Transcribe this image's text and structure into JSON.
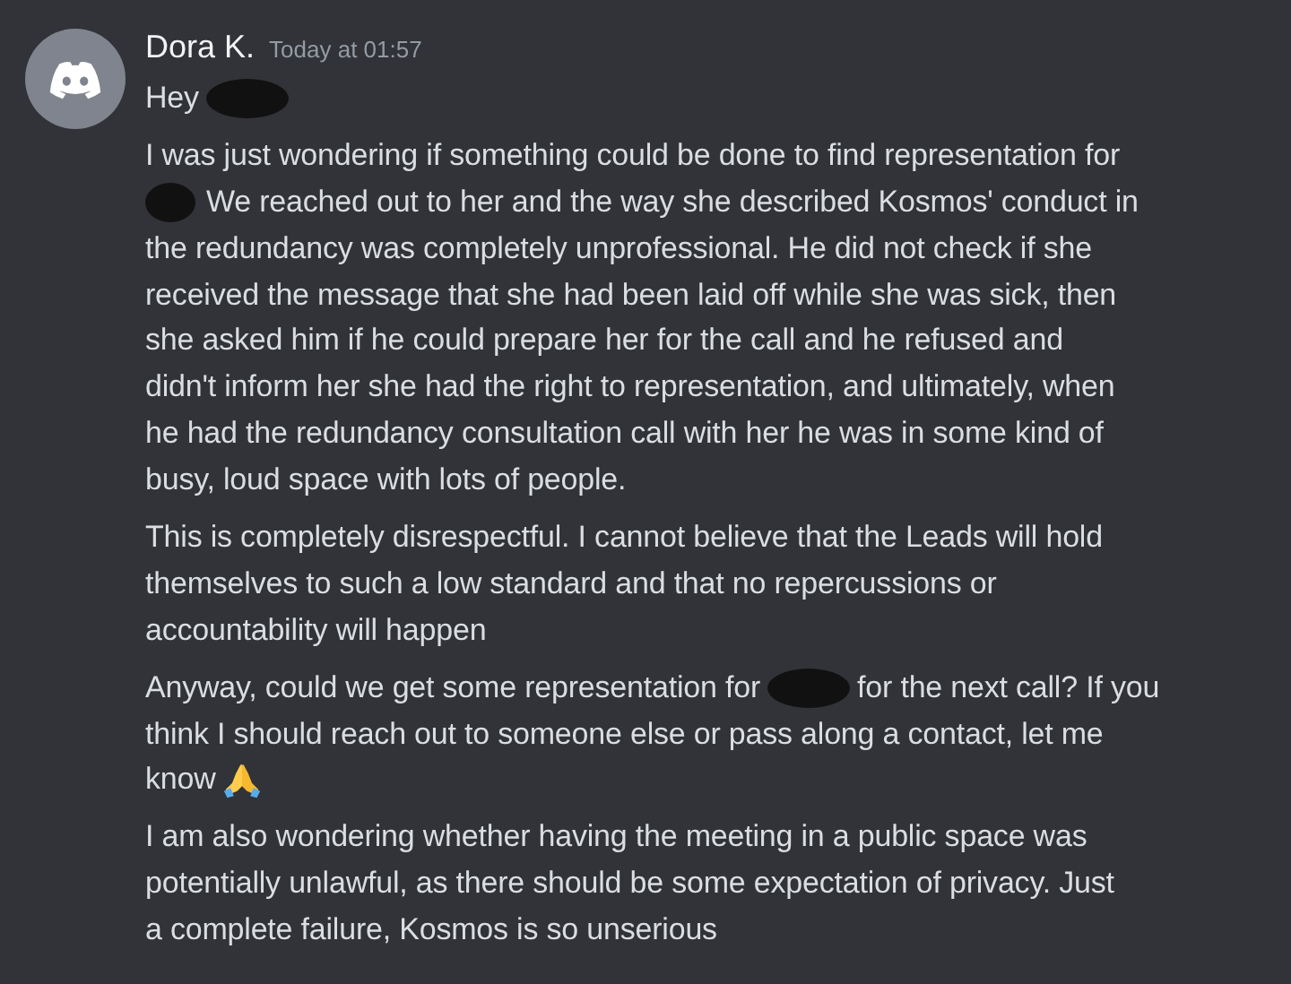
{
  "message": {
    "author": "Dora K.",
    "timestamp": "Today at 01:57",
    "paragraphs": [
      {
        "lines": [
          {
            "segments": [
              {
                "kind": "text",
                "text": "Hey"
              },
              {
                "kind": "redaction"
              }
            ]
          }
        ]
      },
      {
        "lines": [
          {
            "segments": [
              {
                "kind": "text",
                "text": "I was just wondering if something could be done to find representation for"
              }
            ]
          },
          {
            "segments": [
              {
                "kind": "redaction"
              },
              {
                "kind": "text",
                "text": "We reached out to her and the way she described Kosmos' conduct in"
              }
            ]
          },
          {
            "segments": [
              {
                "kind": "text",
                "text": "the redundancy was completely unprofessional. He did not check if she"
              }
            ]
          },
          {
            "segments": [
              {
                "kind": "text",
                "text": "received the message that she had been laid off while she was sick, then"
              }
            ]
          },
          {
            "segments": [
              {
                "kind": "text",
                "text": "she asked him if he could prepare her for the call and he refused and"
              }
            ]
          },
          {
            "segments": [
              {
                "kind": "text",
                "text": "didn't inform her she had the right to representation, and ultimately, when"
              }
            ]
          },
          {
            "segments": [
              {
                "kind": "text",
                "text": "he had the redundancy consultation call with her he was in some kind of"
              }
            ]
          },
          {
            "segments": [
              {
                "kind": "text",
                "text": "busy, loud space with lots of people."
              }
            ]
          }
        ]
      },
      {
        "lines": [
          {
            "segments": [
              {
                "kind": "text",
                "text": "This is completely disrespectful. I cannot believe that the Leads will hold"
              }
            ]
          },
          {
            "segments": [
              {
                "kind": "text",
                "text": "themselves to such a low standard and that no repercussions or"
              }
            ]
          },
          {
            "segments": [
              {
                "kind": "text",
                "text": "accountability will happen"
              }
            ]
          }
        ]
      },
      {
        "lines": [
          {
            "segments": [
              {
                "kind": "text",
                "text": "Anyway, could we get some representation for"
              },
              {
                "kind": "redaction"
              },
              {
                "kind": "text",
                "text": "for the next call? If you"
              }
            ]
          },
          {
            "segments": [
              {
                "kind": "text",
                "text": "think I should reach out to someone else or pass along a contact, let me"
              }
            ]
          },
          {
            "segments": [
              {
                "kind": "text",
                "text": "know"
              },
              {
                "kind": "emoji"
              }
            ]
          }
        ]
      },
      {
        "lines": [
          {
            "segments": [
              {
                "kind": "text",
                "text": "I am also wondering whether having the meeting in a public space was"
              }
            ]
          },
          {
            "segments": [
              {
                "kind": "text",
                "text": "potentially unlawful, as there should be some expectation of privacy. Just"
              }
            ]
          },
          {
            "segments": [
              {
                "kind": "text",
                "text": "a complete failure, Kosmos is so unserious"
              }
            ]
          }
        ]
      }
    ]
  }
}
